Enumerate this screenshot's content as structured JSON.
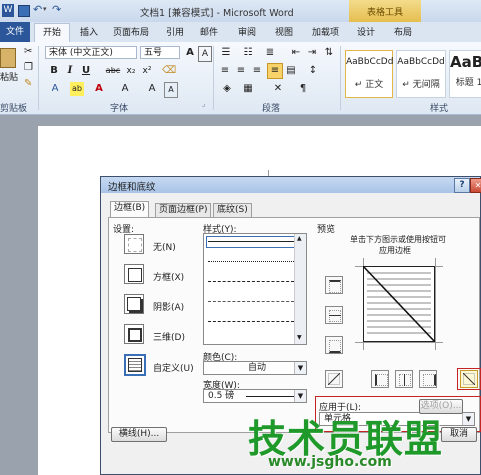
{
  "window": {
    "title": "文档1 [兼容模式] - Microsoft Word",
    "context_tab_group": "表格工具"
  },
  "ribbon_tabs": [
    "文件",
    "开始",
    "插入",
    "页面布局",
    "引用",
    "邮件",
    "审阅",
    "视图",
    "加载项",
    "设计",
    "布局"
  ],
  "ribbon": {
    "clipboard": {
      "paste_label": "粘贴",
      "group_label": "剪贴板"
    },
    "font": {
      "font_name": "宋体 (中文正文)",
      "font_size": "五号",
      "group_label": "字体"
    },
    "paragraph": {
      "group_label": "段落"
    },
    "styles": {
      "group_label": "样式",
      "cards": [
        {
          "sample": "AaBbCcDd",
          "name": "↵ 正文"
        },
        {
          "sample": "AaBbCcDd",
          "name": "↵ 无间隔"
        },
        {
          "sample": "AaBb",
          "name": "标题 1"
        }
      ]
    }
  },
  "dialog": {
    "title": "边框和底纹",
    "help": "?",
    "close": "✕",
    "tabs": [
      "边框(B)",
      "页面边框(P)",
      "底纹(S)"
    ],
    "settings": {
      "label": "设置:",
      "items": [
        "无(N)",
        "方框(X)",
        "阴影(A)",
        "三维(D)",
        "自定义(U)"
      ]
    },
    "style": {
      "label": "样式(Y):"
    },
    "color": {
      "label": "颜色(C):",
      "value": "自动"
    },
    "width": {
      "label": "宽度(W):",
      "value": "0.5 磅"
    },
    "preview": {
      "label": "预览",
      "hint_line1": "单击下方图示或使用按钮可",
      "hint_line2": "应用边框"
    },
    "apply_to": {
      "label": "应用于(L):",
      "value": "单元格"
    },
    "options_button": "选项(O)...",
    "hline_button": "横线(H)...",
    "cancel_button": "取消"
  },
  "watermark": {
    "brand": "技术员联盟",
    "url": "www.jsgho.com"
  }
}
